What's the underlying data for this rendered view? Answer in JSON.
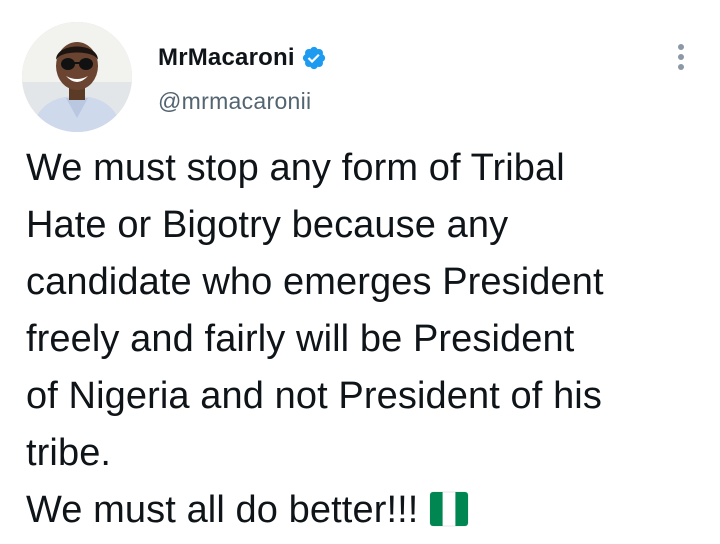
{
  "author": {
    "display_name": "MrMacaroni",
    "handle": "@mrmacaronii",
    "verified": true,
    "avatar_icon": "profile-photo"
  },
  "tweet": {
    "lines": [
      "We must stop any form of Tribal",
      "Hate or Bigotry because any",
      "candidate who emerges President",
      "freely and fairly will be President",
      "of Nigeria and not President of his",
      "tribe.",
      "We must all do better!!!"
    ],
    "trailing_emoji": "nigeria-flag-emoji"
  },
  "colors": {
    "verified_blue": "#1d9bf0",
    "handle_gray": "#536471",
    "text": "#0f1419",
    "flag_green": "#008751"
  },
  "icons": {
    "more": "more-options-icon",
    "verified": "verified-badge-icon"
  }
}
